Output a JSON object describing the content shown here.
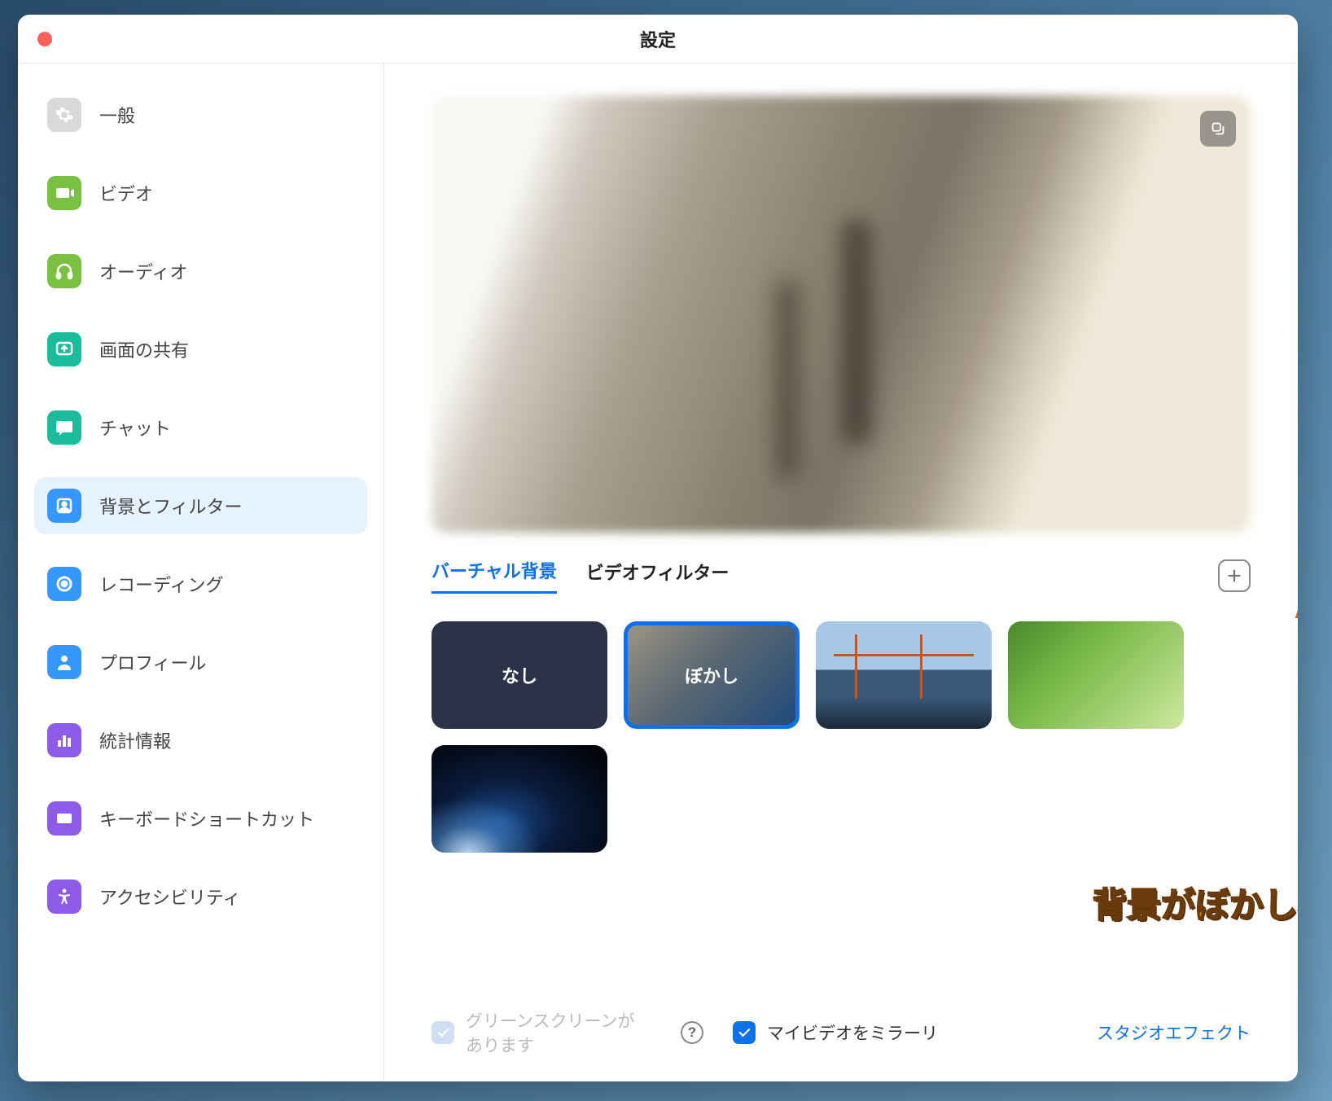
{
  "window": {
    "title": "設定"
  },
  "sidebar": {
    "items": [
      {
        "label": "一般",
        "icon": "gear",
        "color": "#d9d9d9"
      },
      {
        "label": "ビデオ",
        "icon": "video",
        "color": "#7ac142"
      },
      {
        "label": "オーディオ",
        "icon": "headphones",
        "color": "#7ac142"
      },
      {
        "label": "画面の共有",
        "icon": "share-screen",
        "color": "#1abc9c"
      },
      {
        "label": "チャット",
        "icon": "chat",
        "color": "#1abc9c"
      },
      {
        "label": "背景とフィルター",
        "icon": "background",
        "color": "#3498ff",
        "active": true
      },
      {
        "label": "レコーディング",
        "icon": "record",
        "color": "#3498ff"
      },
      {
        "label": "プロフィール",
        "icon": "profile",
        "color": "#3498ff"
      },
      {
        "label": "統計情報",
        "icon": "stats",
        "color": "#8e5ae8"
      },
      {
        "label": "キーボードショートカット",
        "icon": "keyboard",
        "color": "#8e5ae8"
      },
      {
        "label": "アクセシビリティ",
        "icon": "accessibility",
        "color": "#8e5ae8"
      }
    ]
  },
  "tabs": {
    "virtual_bg": "バーチャル背景",
    "video_filter": "ビデオフィルター"
  },
  "backgrounds": {
    "none": "なし",
    "blur": "ぼかし"
  },
  "footer": {
    "green_screen": "グリーンスクリーンがあります",
    "mirror": "マイビデオをミラーリ",
    "studio": "スタジオエフェクト",
    "help": "?"
  },
  "annotation": "背景がぼかし状態になった！"
}
